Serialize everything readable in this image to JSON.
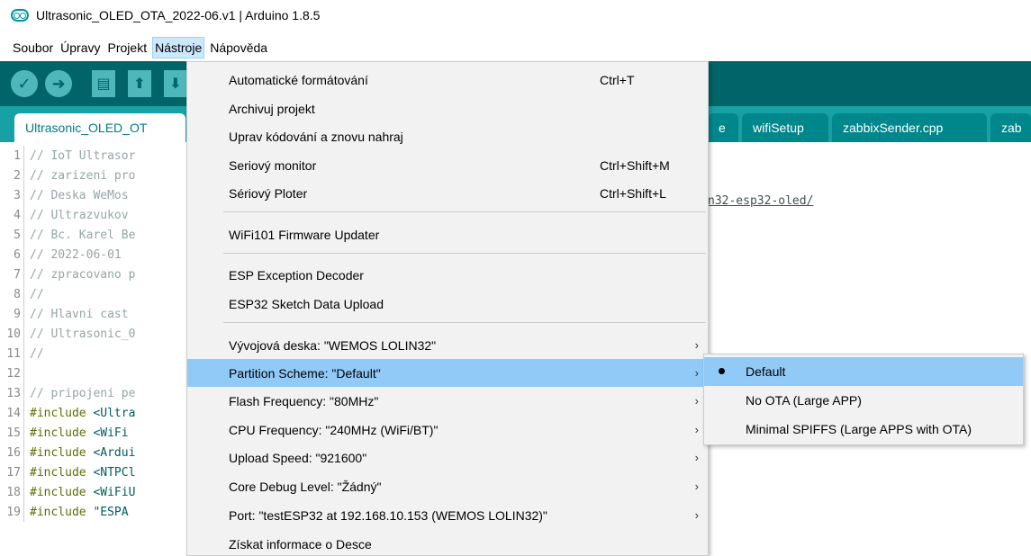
{
  "window": {
    "title": "Ultrasonic_OLED_OTA_2022-06.v1 | Arduino 1.8.5"
  },
  "menubar": {
    "items": [
      "Soubor",
      "Úpravy",
      "Projekt",
      "Nástroje",
      "Nápověda"
    ]
  },
  "tabs": {
    "active": "Ultrasonic_OLED_OT",
    "partial_left": "e",
    "wifi": "wifiSetup",
    "zabbix": "zabbixSender.cpp",
    "partial_right": "zab"
  },
  "editor": {
    "line_numbers": [
      "1",
      "2",
      "3",
      "4",
      "5",
      "6",
      "7",
      "8",
      "9",
      "10",
      "11",
      "12",
      "13",
      "14",
      "15",
      "16",
      "17",
      "18",
      "19"
    ],
    "lines": [
      "// IoT Ultrasor",
      "// zarizeni pro",
      "// Deska WeMos ",
      "// Ultrazvukov",
      "// Bc. Karel Be",
      "// 2022-06-01",
      "// zpracovano p",
      "//",
      "// Hlavni cast",
      "// Ultrasonic_0",
      "//",
      "",
      "// pripojeni pe"
    ],
    "include_kw": "#include",
    "includes": [
      "<Ultra",
      "<WiFi",
      "<Ardui",
      "<NTPCl",
      "<WiFiU",
      "\"ESPA"
    ],
    "link_fragment": "n32-esp32-oled/"
  },
  "tools_menu": {
    "items": [
      {
        "label": "Automatické formátování",
        "shortcut": "Ctrl+T"
      },
      {
        "label": "Archivuj projekt",
        "shortcut": ""
      },
      {
        "label": "Uprav kódování a znovu nahraj",
        "shortcut": ""
      },
      {
        "label": "Seriový monitor",
        "shortcut": "Ctrl+Shift+M"
      },
      {
        "label": "Sériový Ploter",
        "shortcut": "Ctrl+Shift+L"
      },
      {
        "label": "WiFi101 Firmware Updater",
        "shortcut": ""
      },
      {
        "label": "ESP Exception Decoder",
        "shortcut": ""
      },
      {
        "label": "ESP32 Sketch Data Upload",
        "shortcut": ""
      },
      {
        "label": "Vývojová deska: \"WEMOS LOLIN32\"",
        "submenu": true
      },
      {
        "label": "Partition Scheme: \"Default\"",
        "submenu": true,
        "highlighted": true
      },
      {
        "label": "Flash Frequency: \"80MHz\"",
        "submenu": true
      },
      {
        "label": "CPU Frequency: \"240MHz (WiFi/BT)\"",
        "submenu": true
      },
      {
        "label": "Upload Speed: \"921600\"",
        "submenu": true
      },
      {
        "label": "Core Debug Level: \"Žádný\"",
        "submenu": true
      },
      {
        "label": "Port: \"testESP32 at 192.168.10.153 (WEMOS LOLIN32)\"",
        "submenu": true
      },
      {
        "label": "Získat informace o Desce"
      }
    ],
    "arrow": "›"
  },
  "partition_submenu": {
    "items": [
      {
        "label": "Default",
        "selected": true
      },
      {
        "label": "No OTA (Large APP)"
      },
      {
        "label": "Minimal SPIFFS (Large APPS with OTA)"
      }
    ]
  },
  "colors": {
    "toolbar": "#006468",
    "tabbar": "#17a1a5",
    "highlight": "#91c9f7",
    "accent": "#00979d"
  }
}
